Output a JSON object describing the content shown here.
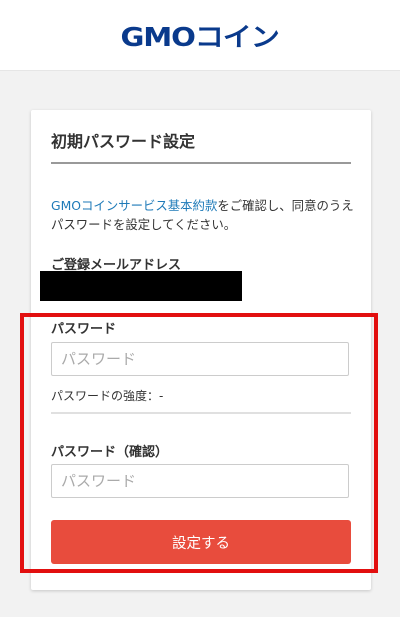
{
  "header": {
    "logo_text": "GMOコイン"
  },
  "form": {
    "title": "初期パスワード設定",
    "intro_link": "GMOコインサービス基本約款",
    "intro_text": "をご確認し、同意のうえパスワードを設定してください。",
    "email_label": "ご登録メールアドレス",
    "password_label": "パスワード",
    "password_placeholder": "パスワード",
    "strength_text": "パスワードの強度：-",
    "confirm_label": "パスワード（確認）",
    "confirm_placeholder": "パスワード",
    "submit_label": "設定する"
  },
  "colors": {
    "brand": "#0a3a8c",
    "link": "#1e7ab8",
    "submit": "#e84c3d",
    "highlight": "#e20f0f"
  }
}
